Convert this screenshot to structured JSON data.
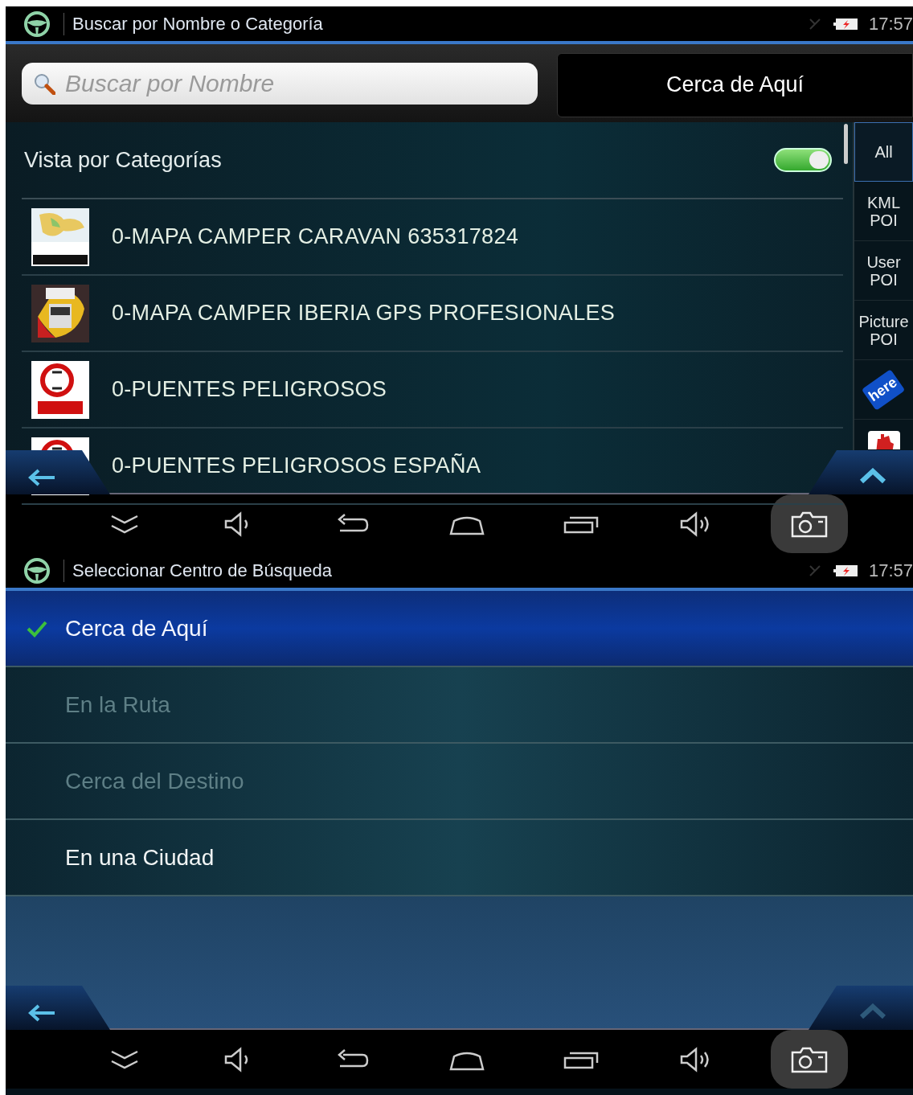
{
  "search_screen": {
    "status_bar": {
      "title": "Buscar por Nombre o Categoría",
      "time": "17:57"
    },
    "search": {
      "placeholder": "Buscar por Nombre"
    },
    "center_button": "Cerca de Aquí",
    "category_view": {
      "label": "Vista por Categorías",
      "on": true
    },
    "categories": [
      {
        "name": "0-MAPA CAMPER CARAVAN 635317824",
        "kind": "map"
      },
      {
        "name": "0-MAPA CAMPER IBERIA GPS PROFESIONALES",
        "kind": "truck"
      },
      {
        "name": "0-PUENTES PELIGROSOS",
        "kind": "sign"
      },
      {
        "name": "0-PUENTES PELIGROSOS ESPAÑA",
        "kind": "sign"
      }
    ],
    "side_tabs": [
      {
        "kind": "text",
        "label": "All",
        "selected": true
      },
      {
        "kind": "text",
        "label": "KML POI",
        "selected": false
      },
      {
        "kind": "text",
        "label": "User POI",
        "selected": false
      },
      {
        "kind": "text",
        "label": "Picture POI",
        "selected": false
      },
      {
        "kind": "logo",
        "label": "here",
        "selected": false
      },
      {
        "kind": "hand",
        "selected": false
      }
    ],
    "up_button": {
      "disabled": false
    }
  },
  "center_screen": {
    "status_bar": {
      "title": "Seleccionar Centro de Búsqueda",
      "time": "17:57"
    },
    "options": [
      {
        "label": "Cerca de Aquí",
        "selected": true,
        "disabled": false
      },
      {
        "label": "En la Ruta",
        "selected": false,
        "disabled": true
      },
      {
        "label": "Cerca del Destino",
        "selected": false,
        "disabled": true
      },
      {
        "label": "En una Ciudad",
        "selected": false,
        "disabled": false
      }
    ],
    "up_button": {
      "disabled": true
    }
  }
}
